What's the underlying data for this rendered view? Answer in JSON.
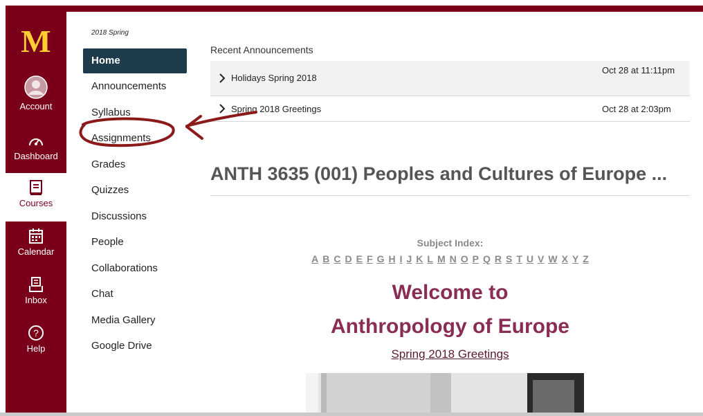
{
  "global_nav": {
    "items": [
      {
        "label": "Account",
        "icon": "account-icon"
      },
      {
        "label": "Dashboard",
        "icon": "dashboard-icon"
      },
      {
        "label": "Courses",
        "icon": "courses-icon",
        "active": true
      },
      {
        "label": "Calendar",
        "icon": "calendar-icon"
      },
      {
        "label": "Inbox",
        "icon": "inbox-icon"
      },
      {
        "label": "Help",
        "icon": "help-icon"
      }
    ],
    "logo_text": "M",
    "brand_color": "#7a0019",
    "logo_color": "#ffcc33"
  },
  "course_nav": {
    "term": "2018 Spring",
    "items": [
      "Home",
      "Announcements",
      "Syllabus",
      "Assignments",
      "Grades",
      "Quizzes",
      "Discussions",
      "People",
      "Collaborations",
      "Chat",
      "Media Gallery",
      "Google Drive"
    ],
    "active_color": "#1e3b4c"
  },
  "announcements": {
    "heading": "Recent Announcements",
    "items": [
      {
        "title": "Holidays Spring 2018",
        "date": "Oct 28 at 11:11pm"
      },
      {
        "title": "Spring 2018 Greetings",
        "date": "Oct 28 at 2:03pm"
      }
    ]
  },
  "course_title": "ANTH 3635 (001) Peoples and Cultures of Europe ...",
  "subject_index": {
    "label": "Subject Index:",
    "letters": [
      "A",
      "B",
      "C",
      "D",
      "E",
      "F",
      "G",
      "H",
      "I",
      "J",
      "K",
      "L",
      "M",
      "N",
      "O",
      "P",
      "Q",
      "R",
      "S",
      "T",
      "U",
      "V",
      "W",
      "X",
      "Y",
      "Z"
    ]
  },
  "welcome": {
    "line1": "Welcome to",
    "line2": "Anthropology of Europe",
    "link": "Spring 2018 Greetings",
    "accent": "#8a2d55"
  }
}
